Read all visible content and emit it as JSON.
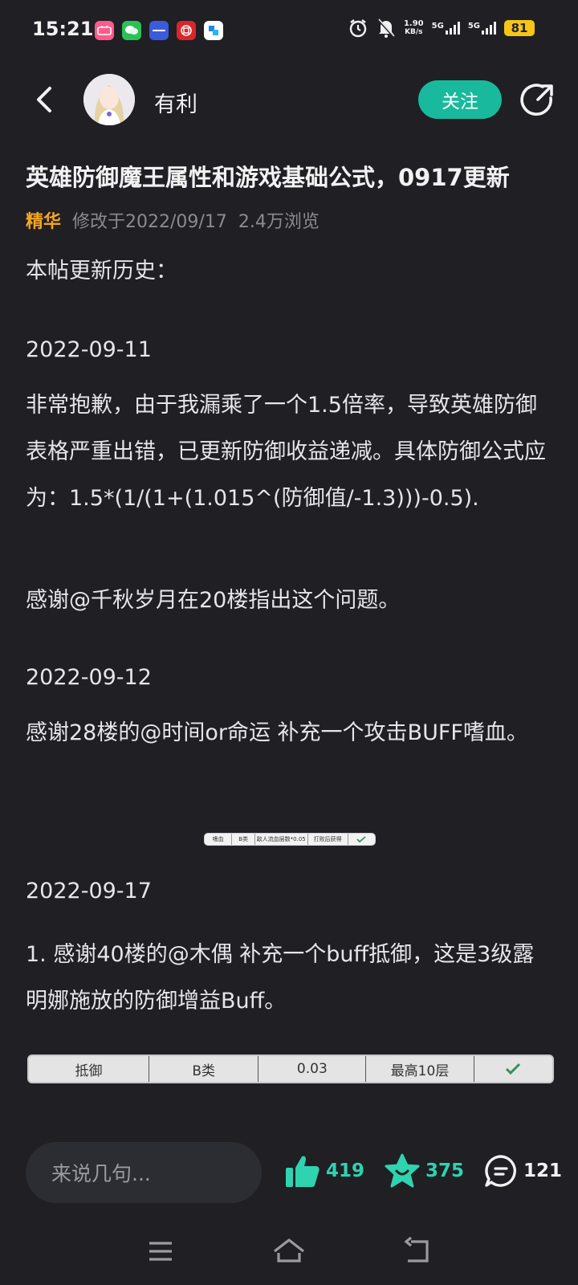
{
  "status_bar": {
    "time": "15:21",
    "net_speed_value": "1.90",
    "net_speed_unit": "KB/s",
    "sim1": "5G",
    "sim2": "5G",
    "battery": "81"
  },
  "header": {
    "username": "有利",
    "follow_label": "关注"
  },
  "post": {
    "title": "英雄防御魔王属性和游戏基础公式，0917更新",
    "tag": "精华",
    "modified": "修改于2022/09/17",
    "views": "2.4万浏览",
    "history_heading": "本帖更新历史：",
    "date1": "2022-09-11",
    "para1": "非常抱歉，由于我漏乘了一个1.5倍率，导致英雄防御表格严重出错，已更新防御收益递减。具体防御公式应为：1.5*(1/(1+(1.015^(防御值/-1.3)))-0.5).",
    "para2": "感谢@千秋岁月在20楼指出这个问题。",
    "date2": "2022-09-12",
    "para3": "感谢28楼的@时间or命运 补充一个攻击BUFF嗜血。",
    "mini_table": [
      "嗜血",
      "B类",
      "敌人流血层数*0.05",
      "打败后获得"
    ],
    "date3": "2022-09-17",
    "para4": "1. 感谢40楼的@木偶 补充一个buff抵御，这是3级露明娜施放的防御增益Buff。",
    "buff_table": [
      "抵御",
      "B类",
      "0.03",
      "最高10层"
    ]
  },
  "bottom_bar": {
    "comment_placeholder": "来说几句...",
    "likes": "419",
    "favorites": "375",
    "comments": "121"
  },
  "colors": {
    "background": "#1f1f24",
    "accent": "#18b99c",
    "tag": "#f4a523"
  }
}
